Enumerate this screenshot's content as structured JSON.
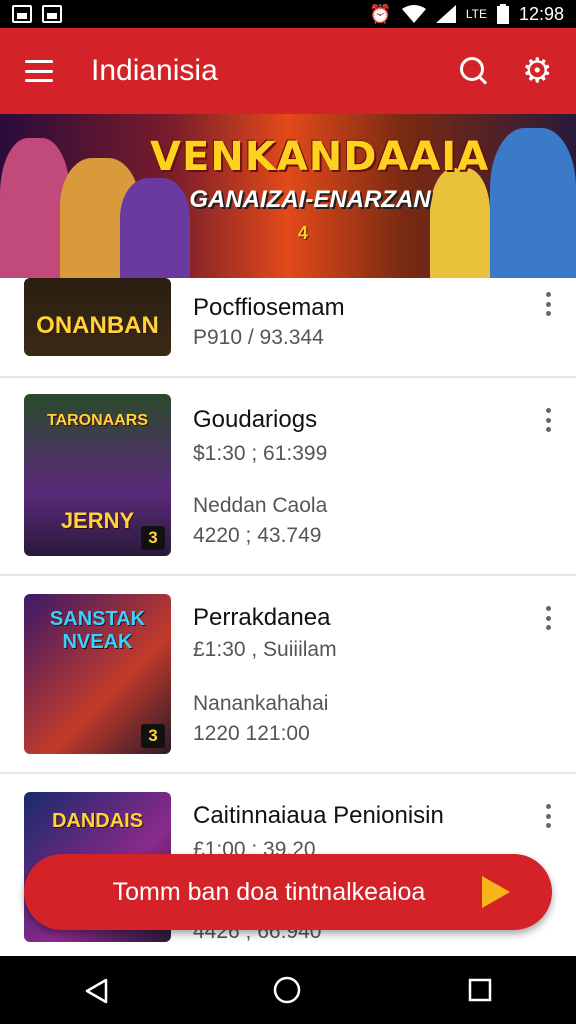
{
  "status_bar": {
    "time": "12:98",
    "network_label": "LTE"
  },
  "app_bar": {
    "title": "Indianisia"
  },
  "banner": {
    "title": "VENKANDAAIA",
    "subtitle": "GANAIZAI-ENARZAN",
    "badge": "4"
  },
  "list": [
    {
      "thumb_label": "ONANBAN",
      "thumb_number": "",
      "title": "Pocffiosemam",
      "meta1": "P910 / 93.344",
      "subtitle": "",
      "meta2": ""
    },
    {
      "thumb_label": "TARONAARS",
      "thumb_label_bottom": "JERNY",
      "thumb_number": "3",
      "title": "Goudariogs",
      "meta1": "$1:30 ; 61:399",
      "subtitle": "Neddan Caola",
      "meta2": "4220 ; 43.749"
    },
    {
      "thumb_label": "SANSTAK NVEAK",
      "thumb_number": "3",
      "title": "Perrakdanea",
      "meta1": "£1:30 , Suiiilam",
      "subtitle": "Nanankahahai",
      "meta2": "1220 121:00"
    },
    {
      "thumb_label": "DANDAIS",
      "thumb_number": "",
      "title": "Caitinnaiaua Penionisin",
      "meta1": "£1:00 ; 39.20",
      "subtitle": "",
      "meta2": "4426 ; 66.940"
    }
  ],
  "cta": {
    "label": "Tomm ban doa tintnalkeaioa"
  },
  "colors": {
    "primary": "#d32329",
    "accent": "#f7b51a"
  },
  "icons": [
    "image-icon",
    "gallery-icon",
    "alarm-icon",
    "wifi-icon",
    "signal-icon",
    "battery-icon",
    "menu-icon",
    "search-icon",
    "gear-icon",
    "more-vert-icon",
    "play-icon",
    "nav-back-icon",
    "nav-home-icon",
    "nav-recents-icon"
  ]
}
